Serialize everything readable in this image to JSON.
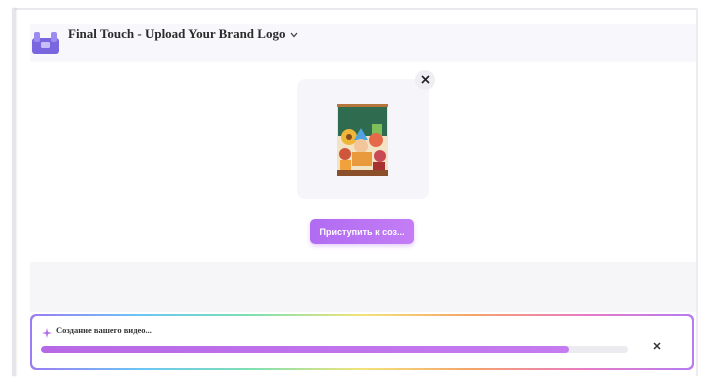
{
  "header": {
    "title": "Final Touch - Upload Your Brand Logo",
    "logo_icon": "brand-logo-icon",
    "dropdown_icon": "chevron-down-icon"
  },
  "preview": {
    "close_icon": "close-icon",
    "thumbnail_icon": "classroom-illustration-icon"
  },
  "start_button": {
    "label": "Приступить к соз..."
  },
  "progress": {
    "label": "Создание вашего видео...",
    "percent": 90,
    "icon": "sparkle-icon",
    "close_icon": "close-icon"
  },
  "colors": {
    "accent": "#b06cf2",
    "progress_fill": "#bd70eb",
    "track": "#ececf0"
  }
}
